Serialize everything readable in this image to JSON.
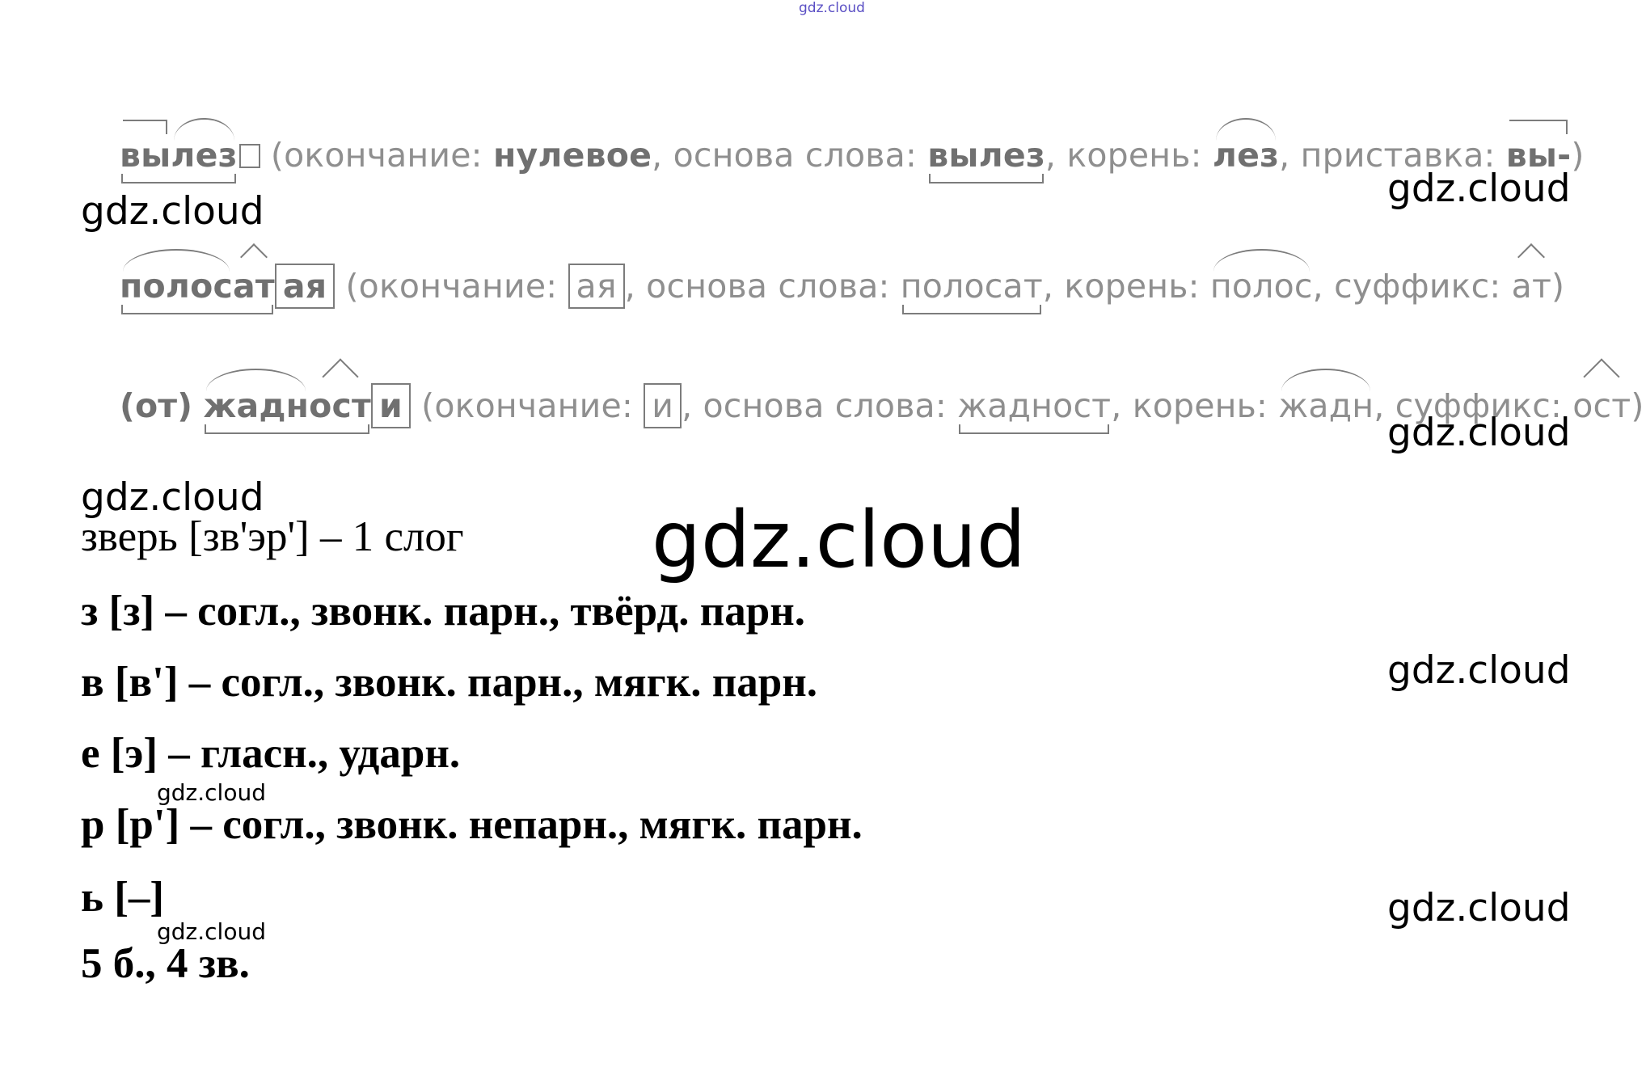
{
  "watermarks": {
    "top_small": "gdz.cloud",
    "label": "gdz.cloud",
    "big": "gdz.cloud"
  },
  "morphemic": {
    "line1": {
      "prefix": "вы",
      "root": "лез",
      "open": " (окончание: ",
      "ending": "нулевое",
      "mid1": ", основа слова: ",
      "stem": "вылез",
      "mid2": ", корень: ",
      "root_val": "лез",
      "mid3": ", приставка: ",
      "prefix_val": "вы-",
      "close": ")"
    },
    "line2": {
      "root": "полос",
      "suffix": "ат",
      "ending": "ая",
      "open": " (окончание: ",
      "ending_val": "ая",
      "mid1": ", основа слова: ",
      "stem": "полосат",
      "mid2": ", корень: ",
      "root_val": "полос",
      "mid3": ", суффикс: ",
      "suffix_val": "ат",
      "close": ")"
    },
    "line3": {
      "prep": "(от)",
      "root": "жадн",
      "suffix": "ост",
      "ending": "и",
      "open": " (окончание: ",
      "ending_val": "и",
      "mid1": ", основа слова: ",
      "stem": "жадност",
      "mid2": ", корень: ",
      "root_val": "жадн",
      "mid3": ", суффикс: ",
      "suffix_val": "ост",
      "close": ")"
    }
  },
  "phonetic": {
    "header": "зверь [зв'эр'] – 1 слог",
    "lines": [
      "з [з] – согл., звонк. парн., твёрд. парн.",
      "в [в'] – согл., звонк. парн., мягк. парн.",
      "е [э] – гласн., ударн.",
      "р [р'] – согл., звонк. непарн., мягк. парн.",
      "ь [–]",
      "5 б., 4 зв."
    ]
  }
}
